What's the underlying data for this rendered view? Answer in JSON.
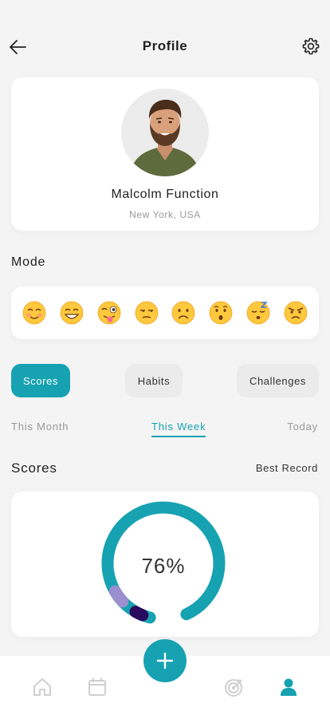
{
  "header": {
    "title": "Profile",
    "back_icon": "arrow-left-icon",
    "settings_icon": "gear-icon"
  },
  "profile": {
    "name": "Malcolm Function",
    "location": "New York, USA"
  },
  "mode": {
    "label": "Mode",
    "emojis": [
      {
        "icon": "smiling-blush-emoji"
      },
      {
        "icon": "grinning-emoji"
      },
      {
        "icon": "winking-tongue-emoji"
      },
      {
        "icon": "unamused-emoji"
      },
      {
        "icon": "frowning-emoji"
      },
      {
        "icon": "hushed-emoji"
      },
      {
        "icon": "sleeping-emoji"
      },
      {
        "icon": "angry-emoji"
      }
    ]
  },
  "tabs": {
    "scores": "Scores",
    "habits": "Habits",
    "challenges": "Challenges",
    "active": "Scores"
  },
  "periods": {
    "month": "This Month",
    "week": "This Week",
    "today": "Today",
    "active": "This Week"
  },
  "scores": {
    "title": "Scores",
    "best_record": "Best Record",
    "percent_label": "76%",
    "percent_value": 76
  },
  "nav": {
    "items": [
      "home-icon",
      "calendar-icon",
      "plus-icon",
      "target-icon",
      "user-icon"
    ],
    "active": "user-icon"
  },
  "colors": {
    "accent": "#17a2b2",
    "tab_inactive": "#ebebeb",
    "ring_purple_light": "#9b8fd0",
    "ring_purple_dark": "#2a0a5e",
    "nav_inactive": "#cfcfcf"
  }
}
